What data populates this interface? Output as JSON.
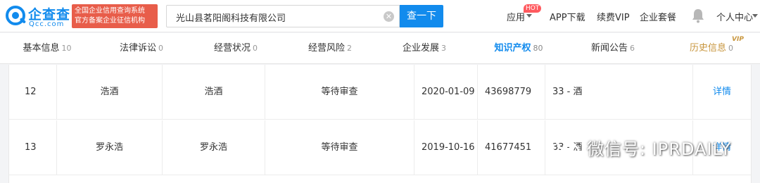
{
  "brand": {
    "name": "企查查",
    "domain": "Qcc.com",
    "slogan_line1": "全国企业信用查询系统",
    "slogan_line2": "官方备案企业征信机构",
    "color": "#128bed"
  },
  "search": {
    "value": "光山县茗阳阁科技有限公司",
    "button_label": "查一下"
  },
  "topnav": {
    "apps_label": "应用",
    "hot_badge": "HOT",
    "download_label": "APP下载",
    "vip_label": "续费VIP",
    "package_label": "企业套餐",
    "user_label": "个人中心"
  },
  "tabs": [
    {
      "label": "基本信息",
      "count": "10"
    },
    {
      "label": "法律诉讼",
      "count": "0"
    },
    {
      "label": "经营状况",
      "count": "0"
    },
    {
      "label": "经营风险",
      "count": "2"
    },
    {
      "label": "企业发展",
      "count": "3"
    },
    {
      "label": "知识产权",
      "count": "80",
      "active": true
    },
    {
      "label": "新闻公告",
      "count": "6"
    },
    {
      "label": "历史信息",
      "count": "0",
      "badge": "VIP"
    }
  ],
  "rows": [
    {
      "no": "12",
      "mark": "浩酒",
      "name": "浩酒",
      "status": "等待审查",
      "date": "2020-01-09",
      "reg_no": "43698779",
      "class": "33 - 酒",
      "action": "详情"
    },
    {
      "no": "13",
      "mark": "罗永浩",
      "name": "罗永浩",
      "status": "等待审查",
      "date": "2019-10-16",
      "reg_no": "41677451",
      "class": "33 - 酒",
      "action": "详情"
    }
  ],
  "watermark": {
    "text": "微信号: IPRDAILY"
  },
  "colors": {
    "accent": "#128bed",
    "hot": "#ff5a5f",
    "slogan_bg": "#e85d4a",
    "vip_gold": "#c8963e"
  }
}
